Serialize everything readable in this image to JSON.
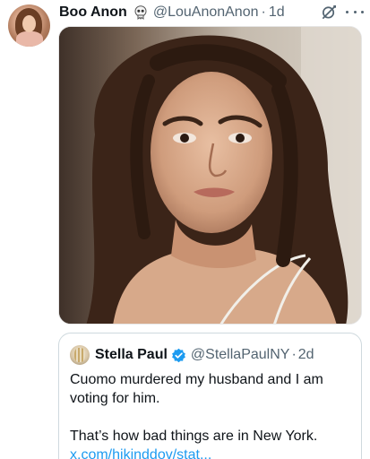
{
  "tweet": {
    "display_name": "Boo Anon",
    "name_emoji_icon": "skull-ghost-icon",
    "handle": "@LouAnonAnon",
    "separator": "·",
    "time": "1d",
    "actions": {
      "grok_icon": "grok-icon",
      "more_icon": "more-icon"
    }
  },
  "media": {
    "kind": "photo",
    "icon": "photo-woman-grimace"
  },
  "quote": {
    "display_name": "Stella Paul",
    "verified_icon": "verified-badge-icon",
    "handle": "@StellaPaulNY",
    "separator": "·",
    "time": "2d",
    "line1": "Cuomo murdered my husband and I am",
    "line2": "voting for him.",
    "line3": "That’s how bad things are in New York.",
    "link": "x.com/hikinddov/stat..."
  },
  "colors": {
    "text": "#0f1419",
    "muted": "#536471",
    "link": "#1d9bf0",
    "verified": "#1d9bf0",
    "border": "#cfd9de"
  }
}
